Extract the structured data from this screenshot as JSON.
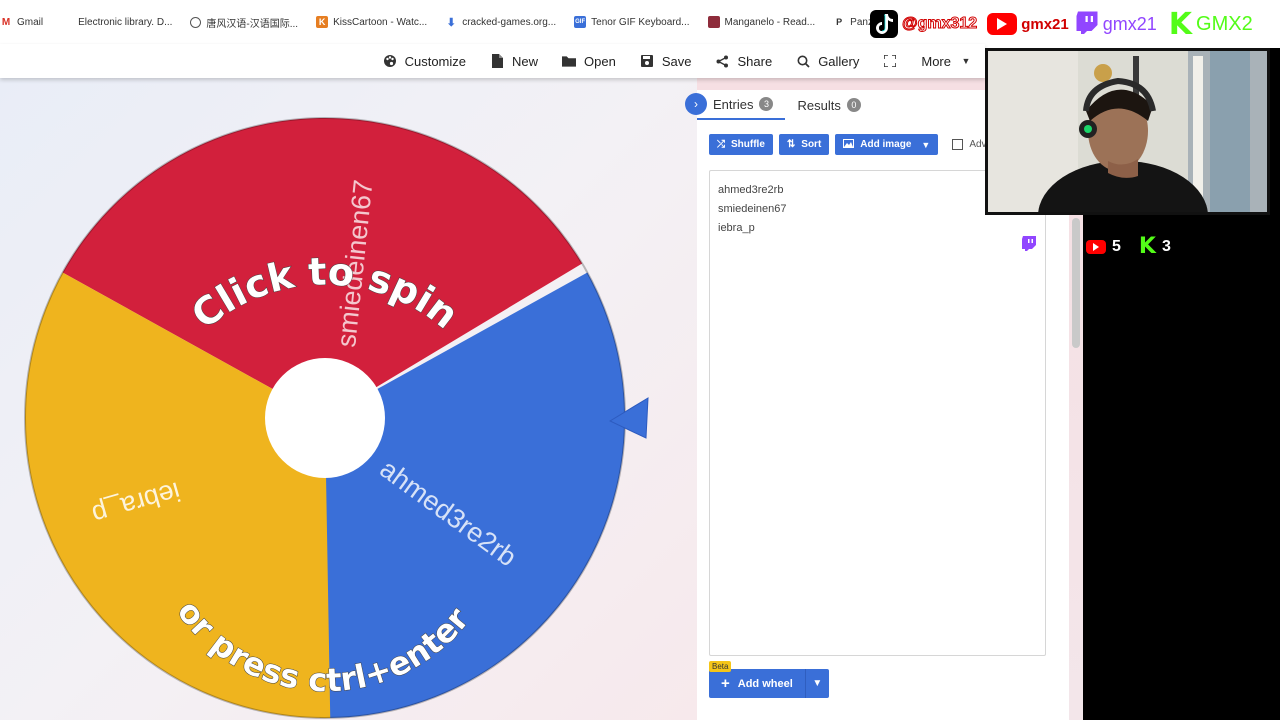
{
  "bookmarks": [
    {
      "label": "Gmail",
      "icon": "gmail-icon",
      "color": "#d93025"
    },
    {
      "label": "Electronic library. D...",
      "icon": "library-icon",
      "color": "#6a6a6a"
    },
    {
      "label": "唐风汉语-汉语国际...",
      "icon": "globe-icon",
      "color": "#555555"
    },
    {
      "label": "KissCartoon - Watc...",
      "icon": "kisscartoon-icon",
      "color": "#e67e22"
    },
    {
      "label": "cracked-games.org...",
      "icon": "download-icon",
      "color": "#3a6fd8"
    },
    {
      "label": "Tenor GIF Keyboard...",
      "icon": "gif-icon",
      "color": "#3a6fd8"
    },
    {
      "label": "Manganelo - Read...",
      "icon": "manga-icon",
      "color": "#8e2c3b"
    },
    {
      "label": "Panzoid",
      "icon": "panzoid-icon",
      "color": "#333333"
    }
  ],
  "toolbar": {
    "customize": "Customize",
    "new": "New",
    "open": "Open",
    "save": "Save",
    "share": "Share",
    "gallery": "Gallery",
    "more": "More"
  },
  "wheel": {
    "segments": [
      {
        "label": "smiedeinen67",
        "color": "#d2203c"
      },
      {
        "label": "ahmed3re2rb",
        "color": "#3a6fd8"
      },
      {
        "label": "iebra_p",
        "color": "#efb41e"
      }
    ],
    "overlay_top": "Click to spin",
    "overlay_bottom": "or press ctrl+enter",
    "pointer_color": "#3a6fd8"
  },
  "tabs": {
    "entries_label": "Entries",
    "entries_count": "3",
    "results_label": "Results",
    "results_count": "0"
  },
  "actions": {
    "shuffle": "Shuffle",
    "sort": "Sort",
    "add_image": "Add image",
    "advanced": "Adva"
  },
  "entries": [
    "ahmed3re2rb",
    "smiedeinen67",
    "iebra_p"
  ],
  "add_wheel": {
    "label": "Add wheel",
    "beta": "Beta"
  },
  "stream": {
    "tiktok": "@gmx312",
    "youtube": "gmx21",
    "twitch": "gmx21",
    "kick": "GMX2",
    "youtube_count": "5",
    "kick_count": "3"
  }
}
